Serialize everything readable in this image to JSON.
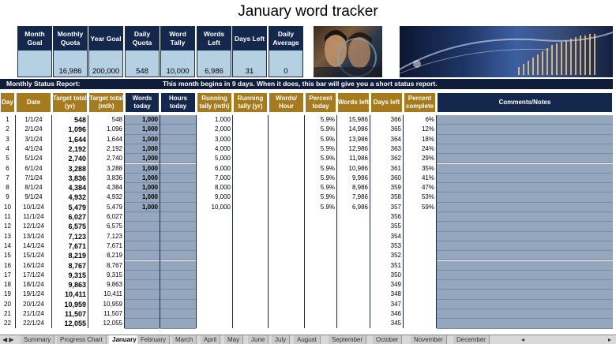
{
  "title": "January word tracker",
  "summary": [
    {
      "label": "Month Goal",
      "value": ""
    },
    {
      "label": "Monthly Quota",
      "value": "16,986"
    },
    {
      "label": "Year Goal",
      "value": "200,000"
    },
    {
      "label": "Daily Quota",
      "value": "548"
    },
    {
      "label": "Word Tally",
      "value": "10,000"
    },
    {
      "label": "Words Left",
      "value": "6,986"
    },
    {
      "label": "Days Left",
      "value": "31"
    },
    {
      "label": "Daily Average",
      "value": "0"
    }
  ],
  "status": {
    "label": "Monthly Status Report:",
    "message": "This month begins in 9 days.  When it does, this bar will give you a short status report."
  },
  "headers": [
    "Day",
    "Date",
    "Target total (yr)",
    "Target total (mth)",
    "Words today",
    "Hours today",
    "Running tally (mth)",
    "Running tally (yr)",
    "Words/ Hour",
    "Percent today",
    "Words left",
    "Days left",
    "Percent complete",
    "Comments/Notes"
  ],
  "rows": [
    {
      "day": "1",
      "date": "1/1/24",
      "tyr": "548",
      "tmth": "548",
      "words": "1,000",
      "run": "1,000",
      "pct": "5.9%",
      "left": "15,986",
      "days": "366",
      "comp": "6%"
    },
    {
      "day": "2",
      "date": "2/1/24",
      "tyr": "1,096",
      "tmth": "1,096",
      "words": "1,000",
      "run": "2,000",
      "pct": "5.9%",
      "left": "14,986",
      "days": "365",
      "comp": "12%"
    },
    {
      "day": "3",
      "date": "3/1/24",
      "tyr": "1,644",
      "tmth": "1,644",
      "words": "1,000",
      "run": "3,000",
      "pct": "5.9%",
      "left": "13,986",
      "days": "364",
      "comp": "18%"
    },
    {
      "day": "4",
      "date": "4/1/24",
      "tyr": "2,192",
      "tmth": "2,192",
      "words": "1,000",
      "run": "4,000",
      "pct": "5.9%",
      "left": "12,986",
      "days": "363",
      "comp": "24%"
    },
    {
      "day": "5",
      "date": "5/1/24",
      "tyr": "2,740",
      "tmth": "2,740",
      "words": "1,000",
      "run": "5,000",
      "pct": "5.9%",
      "left": "11,986",
      "days": "362",
      "comp": "29%"
    },
    {
      "day": "6",
      "date": "6/1/24",
      "tyr": "3,288",
      "tmth": "3,288",
      "words": "1,000",
      "run": "6,000",
      "pct": "5.9%",
      "left": "10,986",
      "days": "361",
      "comp": "35%"
    },
    {
      "day": "7",
      "date": "7/1/24",
      "tyr": "3,836",
      "tmth": "3,836",
      "words": "1,000",
      "run": "7,000",
      "pct": "5.9%",
      "left": "9,986",
      "days": "360",
      "comp": "41%"
    },
    {
      "day": "8",
      "date": "8/1/24",
      "tyr": "4,384",
      "tmth": "4,384",
      "words": "1,000",
      "run": "8,000",
      "pct": "5.9%",
      "left": "8,986",
      "days": "359",
      "comp": "47%"
    },
    {
      "day": "9",
      "date": "9/1/24",
      "tyr": "4,932",
      "tmth": "4,932",
      "words": "1,000",
      "run": "9,000",
      "pct": "5.9%",
      "left": "7,986",
      "days": "358",
      "comp": "53%"
    },
    {
      "day": "10",
      "date": "10/1/24",
      "tyr": "5,479",
      "tmth": "5,479",
      "words": "1,000",
      "run": "10,000",
      "pct": "5.9%",
      "left": "6,986",
      "days": "357",
      "comp": "59%"
    },
    {
      "day": "11",
      "date": "11/1/24",
      "tyr": "6,027",
      "tmth": "6,027",
      "words": "",
      "run": "",
      "pct": "",
      "left": "",
      "days": "356",
      "comp": ""
    },
    {
      "day": "12",
      "date": "12/1/24",
      "tyr": "6,575",
      "tmth": "6,575",
      "words": "",
      "run": "",
      "pct": "",
      "left": "",
      "days": "355",
      "comp": ""
    },
    {
      "day": "13",
      "date": "13/1/24",
      "tyr": "7,123",
      "tmth": "7,123",
      "words": "",
      "run": "",
      "pct": "",
      "left": "",
      "days": "354",
      "comp": ""
    },
    {
      "day": "14",
      "date": "14/1/24",
      "tyr": "7,671",
      "tmth": "7,671",
      "words": "",
      "run": "",
      "pct": "",
      "left": "",
      "days": "353",
      "comp": ""
    },
    {
      "day": "15",
      "date": "15/1/24",
      "tyr": "8,219",
      "tmth": "8,219",
      "words": "",
      "run": "",
      "pct": "",
      "left": "",
      "days": "352",
      "comp": ""
    },
    {
      "day": "16",
      "date": "16/1/24",
      "tyr": "8,767",
      "tmth": "8,767",
      "words": "",
      "run": "",
      "pct": "",
      "left": "",
      "days": "351",
      "comp": ""
    },
    {
      "day": "17",
      "date": "17/1/24",
      "tyr": "9,315",
      "tmth": "9,315",
      "words": "",
      "run": "",
      "pct": "",
      "left": "",
      "days": "350",
      "comp": ""
    },
    {
      "day": "18",
      "date": "18/1/24",
      "tyr": "9,863",
      "tmth": "9,863",
      "words": "",
      "run": "",
      "pct": "",
      "left": "",
      "days": "349",
      "comp": ""
    },
    {
      "day": "19",
      "date": "19/1/24",
      "tyr": "10,411",
      "tmth": "10,411",
      "words": "",
      "run": "",
      "pct": "",
      "left": "",
      "days": "348",
      "comp": ""
    },
    {
      "day": "20",
      "date": "20/1/24",
      "tyr": "10,959",
      "tmth": "10,959",
      "words": "",
      "run": "",
      "pct": "",
      "left": "",
      "days": "347",
      "comp": ""
    },
    {
      "day": "21",
      "date": "21/1/24",
      "tyr": "11,507",
      "tmth": "11,507",
      "words": "",
      "run": "",
      "pct": "",
      "left": "",
      "days": "346",
      "comp": ""
    },
    {
      "day": "22",
      "date": "22/1/24",
      "tyr": "12,055",
      "tmth": "12,055",
      "words": "",
      "run": "",
      "pct": "",
      "left": "",
      "days": "345",
      "comp": ""
    }
  ],
  "tabs": [
    "Summary",
    "Progress Chart",
    "January",
    "February",
    "March",
    "April",
    "May",
    "June",
    "July",
    "August",
    "September",
    "October",
    "November",
    "December"
  ],
  "active_tab": "January",
  "colors": {
    "navy": "#14284d",
    "gold": "#a57b1d",
    "light_blue": "#b5cfe3",
    "input_blue": "#94a7bf"
  }
}
